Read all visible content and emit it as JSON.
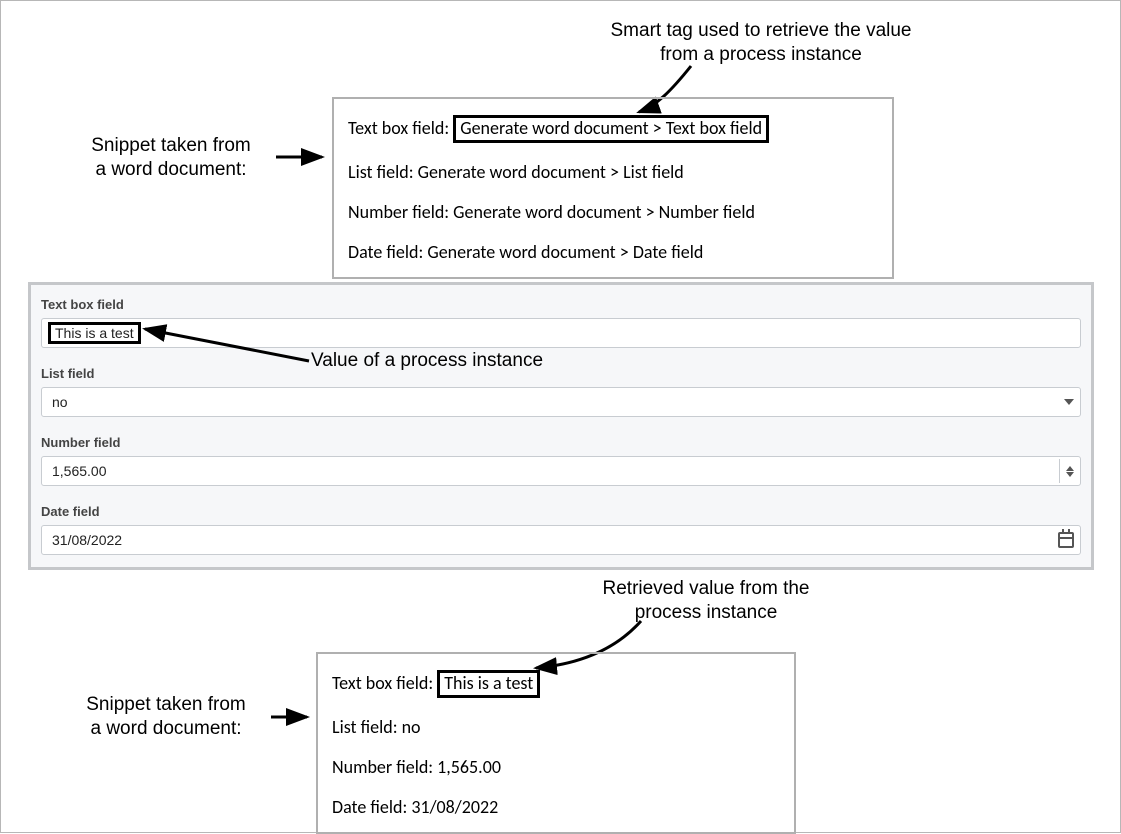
{
  "annotations": {
    "top_caption": "Smart tag used to retrieve the value\nfrom a process instance",
    "left_caption_1": "Snippet taken from\na word document:",
    "mid_caption": "Value of a process instance",
    "bottom_caption": "Retrieved value from the\nprocess instance",
    "left_caption_2": "Snippet taken from\na word document:"
  },
  "top_snippet": {
    "r1_prefix": "Text box field: ",
    "r1_boxed": "Generate word document > Text box field",
    "r2": "List field: Generate word document > List field",
    "r3": "Number field: Generate word document > Number field",
    "r4": "Date field: Generate word document > Date field"
  },
  "form": {
    "textbox": {
      "label": "Text box field",
      "value": "This is a test"
    },
    "list": {
      "label": "List field",
      "value": "no"
    },
    "number": {
      "label": "Number field",
      "value": "1,565.00"
    },
    "date": {
      "label": "Date field",
      "value": "31/08/2022"
    }
  },
  "bottom_snippet": {
    "r1_prefix": "Text box field: ",
    "r1_boxed": "This is a test",
    "r2": "List field: no",
    "r3": "Number field: 1,565.00",
    "r4": "Date field: 31/08/2022"
  }
}
